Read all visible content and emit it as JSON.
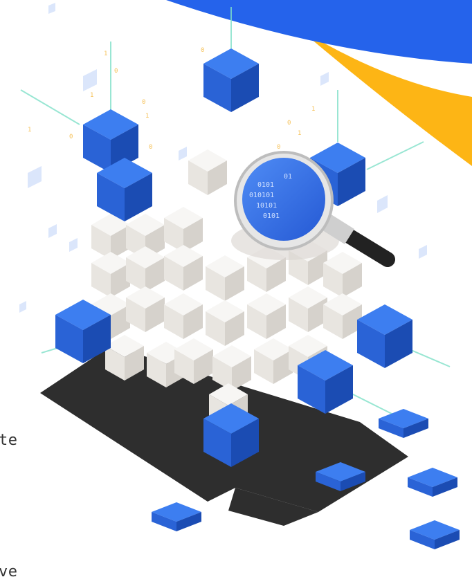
{
  "text_fragments": [
    "te",
    "ve"
  ],
  "illustration": {
    "subject": "isometric data cube with magnifying glass",
    "icons": [
      "magnifying-glass-icon",
      "data-cube-icon"
    ]
  },
  "colors": {
    "cube_blue": "#2f6fe0",
    "cube_blue_dark": "#1c4fb8",
    "white_block": "#f1efec",
    "shadow": "#2e2e2e",
    "accent_yellow": "#fdb515",
    "accent_blue": "#2563eb",
    "binary_digits": "#f6c25a",
    "connector_line": "#7fe0c8"
  }
}
